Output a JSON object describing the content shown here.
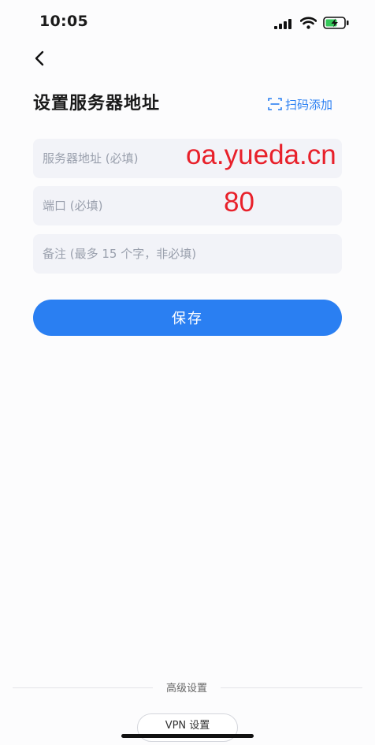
{
  "status_bar": {
    "time": "10:05"
  },
  "header": {
    "title": "设置服务器地址",
    "scan_label": "扫码添加"
  },
  "form": {
    "server_placeholder": "服务器地址 (必填)",
    "port_placeholder": "端口 (必填)",
    "note_placeholder": "备注 (最多 15 个字，非必填)"
  },
  "annotations": {
    "server_value": "oa.yueda.cn",
    "port_value": "80"
  },
  "save_label": "保存",
  "footer": {
    "advanced_label": "高级设置",
    "vpn_label": "VPN 设置"
  },
  "colors": {
    "accent": "#2a7ff2",
    "annotation": "#e8202a"
  }
}
